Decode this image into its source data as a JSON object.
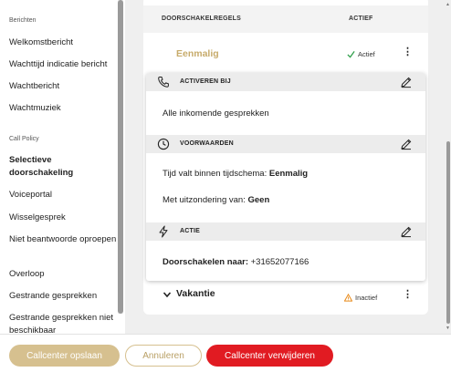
{
  "sidebar": {
    "sections": [
      {
        "label": "Berichten"
      },
      {
        "label": "Call Policy"
      }
    ],
    "items": [
      {
        "label": "Welkomstbericht"
      },
      {
        "label": "Wachttijd indicatie bericht"
      },
      {
        "label": "Wachtbericht"
      },
      {
        "label": "Wachtmuziek"
      },
      {
        "label": "Selectieve doorschakeling"
      },
      {
        "label": "Voiceportal"
      },
      {
        "label": "Wisselgesprek"
      },
      {
        "label": "Niet beantwoorde oproepen"
      },
      {
        "label": "Overloop"
      },
      {
        "label": "Gestrande gesprekken"
      },
      {
        "label": "Gestrande gesprekken niet beschikbaar"
      }
    ],
    "active_item": "Selectieve doorschakeling"
  },
  "table": {
    "header_rules": "DOORSCHAKELREGELS",
    "header_active": "ACTIEF",
    "rows": [
      {
        "name": "Eenmalig",
        "status": "Actief",
        "status_color": "#2e9e4a"
      },
      {
        "name": "Vakantie",
        "status": "Inactief",
        "status_color": "#e88a1a"
      }
    ]
  },
  "details": {
    "activate": {
      "title": "ACTIVEREN BIJ",
      "value": "Alle inkomende gesprekken",
      "icon": "phone-icon"
    },
    "conditions": {
      "title": "VOORWAARDEN",
      "icon": "clock-icon",
      "schedule_label": "Tijd valt binnen tijdschema:",
      "schedule_value": "Eenmalig",
      "exception_label": "Met uitzondering van:",
      "exception_value": "Geen"
    },
    "action": {
      "title": "ACTIE",
      "icon": "lightning-icon",
      "forward_label": "Doorschakelen naar:",
      "forward_value": "+31652077166"
    }
  },
  "footer": {
    "save_label": "Callcenter opslaan",
    "cancel_label": "Annuleren",
    "delete_label": "Callcenter verwijderen"
  },
  "colors": {
    "accent_gold": "#d6c08f",
    "danger_red": "#e11b22",
    "active_green": "#2e9e4a",
    "warning_orange": "#e88a1a"
  }
}
